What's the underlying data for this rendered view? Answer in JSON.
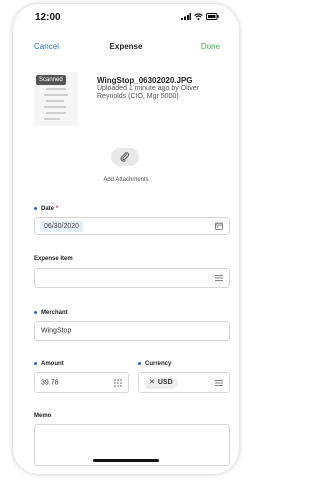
{
  "status_bar": {
    "time": "12:00"
  },
  "header": {
    "cancel_label": "Cancel",
    "title": "Expense",
    "done_label": "Done"
  },
  "receipt": {
    "badge": "Scanned",
    "filename": "WingStop_06302020.JPG",
    "meta": "Uploaded 1 minute ago by Oliver Reynolds (CIO, Mgr 5000)"
  },
  "attachments": {
    "label": "Add Attachments",
    "icon": "paperclip-icon"
  },
  "form": {
    "date": {
      "label": "Date",
      "required_mark": "*",
      "value": "06/30/2020",
      "icon": "calendar-icon"
    },
    "expense_item": {
      "label": "Expense Item",
      "value": "",
      "icon": "list-icon"
    },
    "merchant": {
      "label": "Merchant",
      "value": "WingStop"
    },
    "amount": {
      "label": "Amount",
      "value": "39.78",
      "icon": "calculator-icon"
    },
    "currency": {
      "label": "Currency",
      "value": "USD",
      "remove_glyph": "✕",
      "icon": "list-icon"
    },
    "memo": {
      "label": "Memo",
      "value": ""
    }
  },
  "colors": {
    "accent": "#1d6fd6",
    "done": "#4caf50",
    "required": "#d32f2f"
  }
}
